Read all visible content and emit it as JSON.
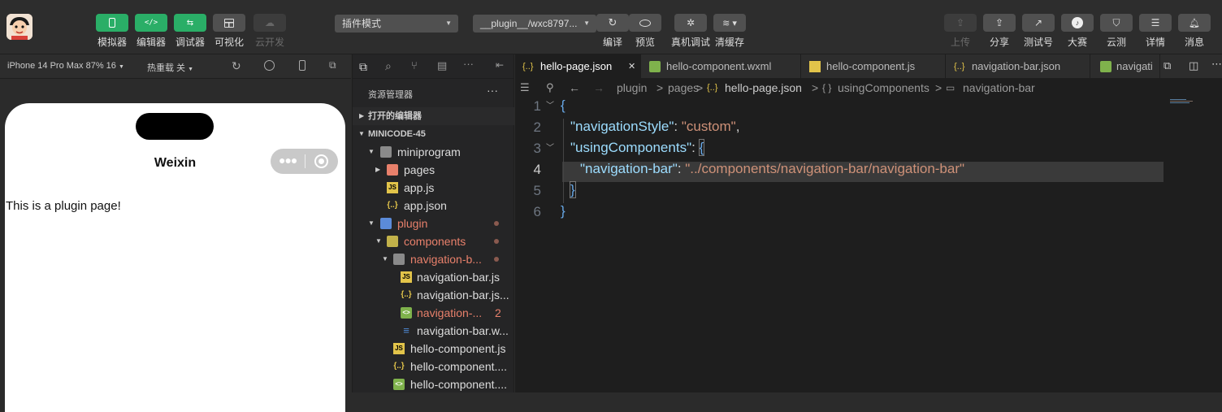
{
  "toolbar": {
    "left_buttons": [
      {
        "label": "模拟器",
        "icon": "phone-icon"
      },
      {
        "label": "编辑器",
        "icon": "code-icon"
      },
      {
        "label": "调试器",
        "icon": "debug-icon"
      },
      {
        "label": "可视化",
        "icon": "layout-icon"
      },
      {
        "label": "云开发",
        "icon": "cloud-icon"
      }
    ],
    "mode_select": "插件模式",
    "path_select": "__plugin__/wxc8797...",
    "mid_buttons": [
      {
        "label": "编译",
        "icon": "refresh-icon"
      },
      {
        "label": "预览",
        "icon": "eye-icon"
      },
      {
        "label": "真机调试",
        "icon": "bug-icon"
      },
      {
        "label": "清缓存",
        "icon": "layers-icon"
      }
    ],
    "right_buttons": [
      {
        "label": "上传",
        "icon": "upload-icon"
      },
      {
        "label": "分享",
        "icon": "share-icon"
      },
      {
        "label": "测试号",
        "icon": "external-icon"
      },
      {
        "label": "大赛",
        "icon": "contest-icon"
      },
      {
        "label": "云测",
        "icon": "cloud-test-icon"
      },
      {
        "label": "详情",
        "icon": "menu-icon"
      },
      {
        "label": "消息",
        "icon": "bell-icon"
      }
    ]
  },
  "simulator": {
    "device": "iPhone 14 Pro Max 87% 16",
    "hot_reload": "热重载 关",
    "nav_title": "Weixin",
    "page_text": "This is a plugin page!"
  },
  "explorer": {
    "title": "资源管理器",
    "more": "···",
    "open_editors": "打开的编辑器",
    "project": "MINICODE-45",
    "items": [
      {
        "label": "miniprogram"
      },
      {
        "label": "pages"
      },
      {
        "label": "app.js"
      },
      {
        "label": "app.json"
      },
      {
        "label": "plugin"
      },
      {
        "label": "components"
      },
      {
        "label": "navigation-b..."
      },
      {
        "label": "navigation-bar.js"
      },
      {
        "label": "navigation-bar.js..."
      },
      {
        "label": "navigation-...",
        "badge": "2"
      },
      {
        "label": "navigation-bar.w..."
      },
      {
        "label": "hello-component.js"
      },
      {
        "label": "hello-component...."
      },
      {
        "label": "hello-component...."
      }
    ]
  },
  "tabs": [
    {
      "label": "hello-page.json",
      "close": "✕"
    },
    {
      "label": "hello-component.wxml"
    },
    {
      "label": "hello-component.js"
    },
    {
      "label": "navigation-bar.json"
    },
    {
      "label": "navigati"
    }
  ],
  "breadcrumb": {
    "parts": [
      "plugin",
      "pages",
      "hello-page.json",
      "usingComponents",
      "navigation-bar"
    ],
    "sep": ">"
  },
  "code": {
    "line_numbers": [
      "1",
      "2",
      "3",
      "4",
      "5",
      "6"
    ],
    "brace_open": "{",
    "brace_close": "}",
    "key_navstyle": "\"navigationStyle\"",
    "val_navstyle": "\"custom\"",
    "key_using": "\"usingComponents\"",
    "key_navbar": "\"navigation-bar\"",
    "val_navbar": "\"../components/navigation-bar/navigation-bar\"",
    "colon": ": ",
    "comma": ","
  },
  "colors": {
    "accent_green": "#2aae67",
    "modified_orange": "#e8806b",
    "json_icon": "#e2c44a"
  }
}
